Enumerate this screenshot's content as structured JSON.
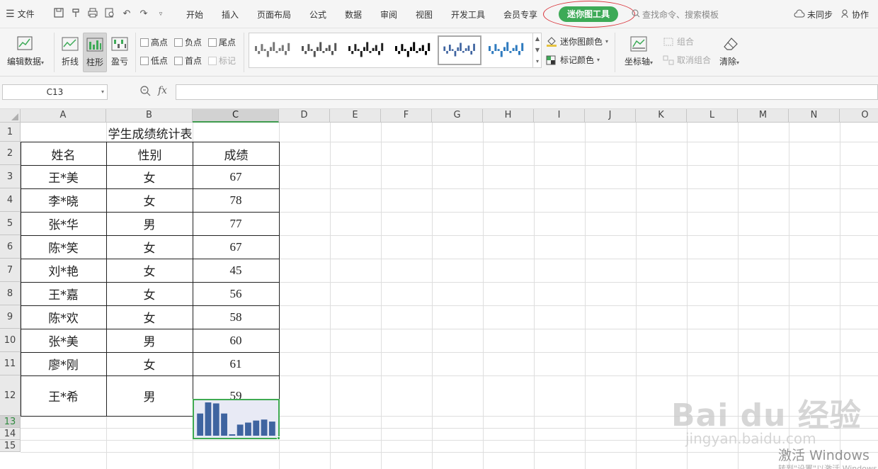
{
  "menu": {
    "file_label": "文件",
    "tabs": [
      "开始",
      "插入",
      "页面布局",
      "公式",
      "数据",
      "审阅",
      "视图",
      "开发工具",
      "会员专享"
    ],
    "active_tab": "迷你图工具",
    "search_placeholder": "查找命令、搜索模板",
    "sync_label": "未同步",
    "collab_label": "协作"
  },
  "ribbon": {
    "edit_data": "编辑数据",
    "line": "折线",
    "column": "柱形",
    "winloss": "盈亏",
    "show": {
      "high": "高点",
      "negative": "负点",
      "last": "尾点",
      "low": "低点",
      "first": "首点",
      "markers": "标记"
    },
    "sparkline_color": "迷你图颜色",
    "marker_color": "标记颜色",
    "axis": "坐标轴",
    "group": "组合",
    "ungroup": "取消组合",
    "clear": "清除"
  },
  "formula_bar": {
    "name_box": "C13",
    "fx_label": "fx",
    "formula": ""
  },
  "columns": [
    "A",
    "B",
    "C",
    "D",
    "E",
    "F",
    "G",
    "H",
    "I",
    "J",
    "K",
    "L",
    "M",
    "N",
    "O"
  ],
  "rows": [
    "1",
    "2",
    "3",
    "4",
    "5",
    "6",
    "7",
    "8",
    "9",
    "10",
    "11",
    "12",
    "13",
    "14",
    "15"
  ],
  "sheet": {
    "title": "学生成绩统计表",
    "headers": [
      "姓名",
      "性别",
      "成绩"
    ],
    "records": [
      {
        "name": "王*美",
        "gender": "女",
        "score": "67"
      },
      {
        "name": "李*晓",
        "gender": "女",
        "score": "78"
      },
      {
        "name": "张*华",
        "gender": "男",
        "score": "77"
      },
      {
        "name": "陈*笑",
        "gender": "女",
        "score": "67"
      },
      {
        "name": "刘*艳",
        "gender": "女",
        "score": "45"
      },
      {
        "name": "王*嘉",
        "gender": "女",
        "score": "56"
      },
      {
        "name": "陈*欢",
        "gender": "女",
        "score": "58"
      },
      {
        "name": "张*美",
        "gender": "男",
        "score": "60"
      },
      {
        "name": "廖*刚",
        "gender": "女",
        "score": "61"
      },
      {
        "name": "王*希",
        "gender": "男",
        "score": "59"
      }
    ]
  },
  "sparkline": {
    "type": "column",
    "values": [
      67,
      78,
      77,
      67,
      45,
      56,
      58,
      60,
      61,
      59
    ],
    "color": "#3f64a0"
  },
  "colors": {
    "accent": "#3daa57",
    "selection": "#3faa51",
    "annotation": "#d9343b"
  },
  "watermark": {
    "brand": "Bai du 经验",
    "url": "jingyan.baidu.com",
    "activate": "激活 Windows",
    "activate_sub": "转到\"设置\"以激活 Windows。"
  }
}
